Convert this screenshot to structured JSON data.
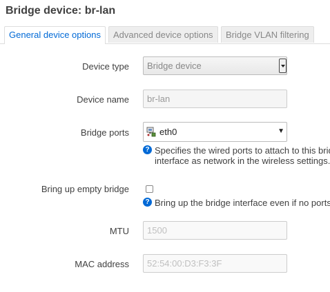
{
  "page": {
    "title": "Bridge device: br-lan"
  },
  "tabs": [
    {
      "label": "General device options",
      "active": true
    },
    {
      "label": "Advanced device options",
      "active": false
    },
    {
      "label": "Bridge VLAN filtering",
      "active": false
    }
  ],
  "form": {
    "device_type": {
      "label": "Device type",
      "value": "Bridge device"
    },
    "device_name": {
      "label": "Device name",
      "value": "br-lan"
    },
    "bridge_ports": {
      "label": "Bridge ports",
      "value": "eth0",
      "help_line1": "Specifies the wired ports to attach to this bridge",
      "help_line2": "interface as network in the wireless settings."
    },
    "bring_up_empty_bridge": {
      "label": "Bring up empty bridge",
      "checked": false,
      "help": "Bring up the bridge interface even if no ports"
    },
    "mtu": {
      "label": "MTU",
      "placeholder": "1500"
    },
    "mac_address": {
      "label": "MAC address",
      "placeholder": "52:54:00:D3:F3:3F"
    }
  },
  "colors": {
    "accent": "#0069d6",
    "text": "#404040",
    "border": "#dddddd"
  }
}
